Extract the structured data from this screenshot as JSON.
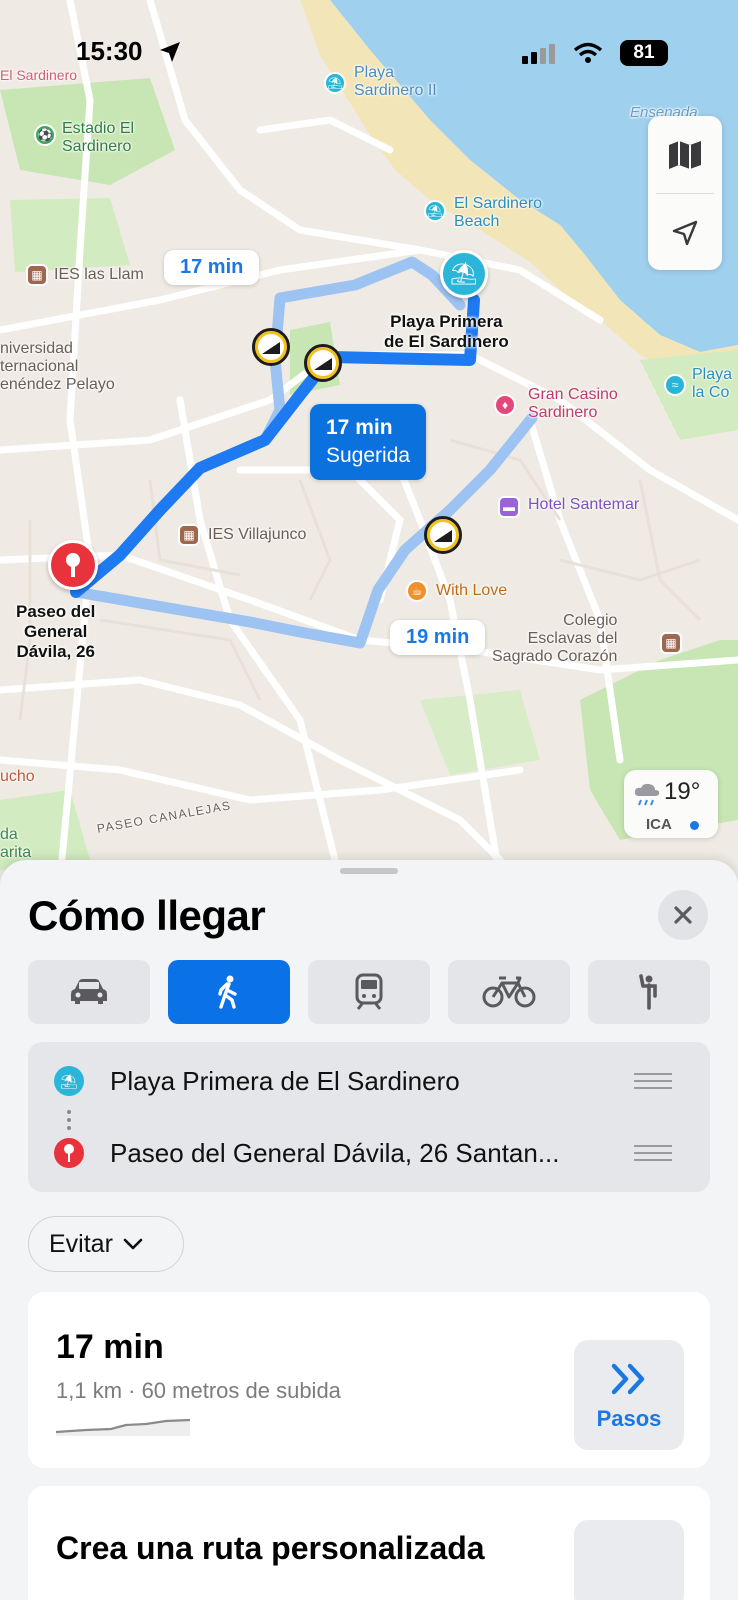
{
  "status_bar": {
    "time": "15:30",
    "battery": "81"
  },
  "map": {
    "labels": {
      "el_sardinero_top": "El Sardinero",
      "playa_sardinero_ii": "Playa\nSardinero II",
      "ensenada": "Ensenada",
      "estadio": "Estadio El\nSardinero",
      "el_sardinero_beach": "El Sardinero\nBeach",
      "ies_llamas": "IES las Llam",
      "universidad": "niversidad\nternacional\nenéndez Pelayo",
      "gran_casino": "Gran Casino\nSardinero",
      "playa_la_co": "Playa\nla Co",
      "hotel_santemar": "Hotel Santemar",
      "ies_villajunco": "IES Villajunco",
      "with_love": "With Love",
      "colegio": "Colegio\nEsclavas del\nSagrado Corazón",
      "lucho": "ucho",
      "paseo_canalejas": "PASEO CANALEJAS",
      "da_arita": "da\narita"
    },
    "origin": "Playa Primera\nde El Sardinero",
    "destination": "Paseo del\nGeneral\nDávila, 26",
    "routes": [
      {
        "time": "17 min",
        "selected": false
      },
      {
        "time": "17 min",
        "subtitle": "Sugerida",
        "selected": true
      },
      {
        "time": "19 min",
        "selected": false
      }
    ],
    "weather": {
      "temp": "19°",
      "aqi": "ICA"
    }
  },
  "sheet": {
    "title": "Cómo llegar",
    "modes": [
      "car-icon",
      "walk-icon",
      "transit-icon",
      "bike-icon",
      "rideshare-icon"
    ],
    "active_mode": "walk-icon",
    "from": "Playa Primera de El Sardinero",
    "to": "Paseo del General Dávila, 26 Santan...",
    "avoid_label": "Evitar",
    "route": {
      "duration": "17 min",
      "details": "1,1 km · 60 metros de subida",
      "steps_label": "Pasos"
    },
    "custom_route_title": "Crea una ruta personalizada"
  },
  "colors": {
    "accent": "#0b71e6",
    "route_line": "#3d8cf0",
    "water": "#9fd0ee",
    "park": "#c8e6b4",
    "beach": "#f2e6b8",
    "destination_pin": "#e8323c"
  }
}
